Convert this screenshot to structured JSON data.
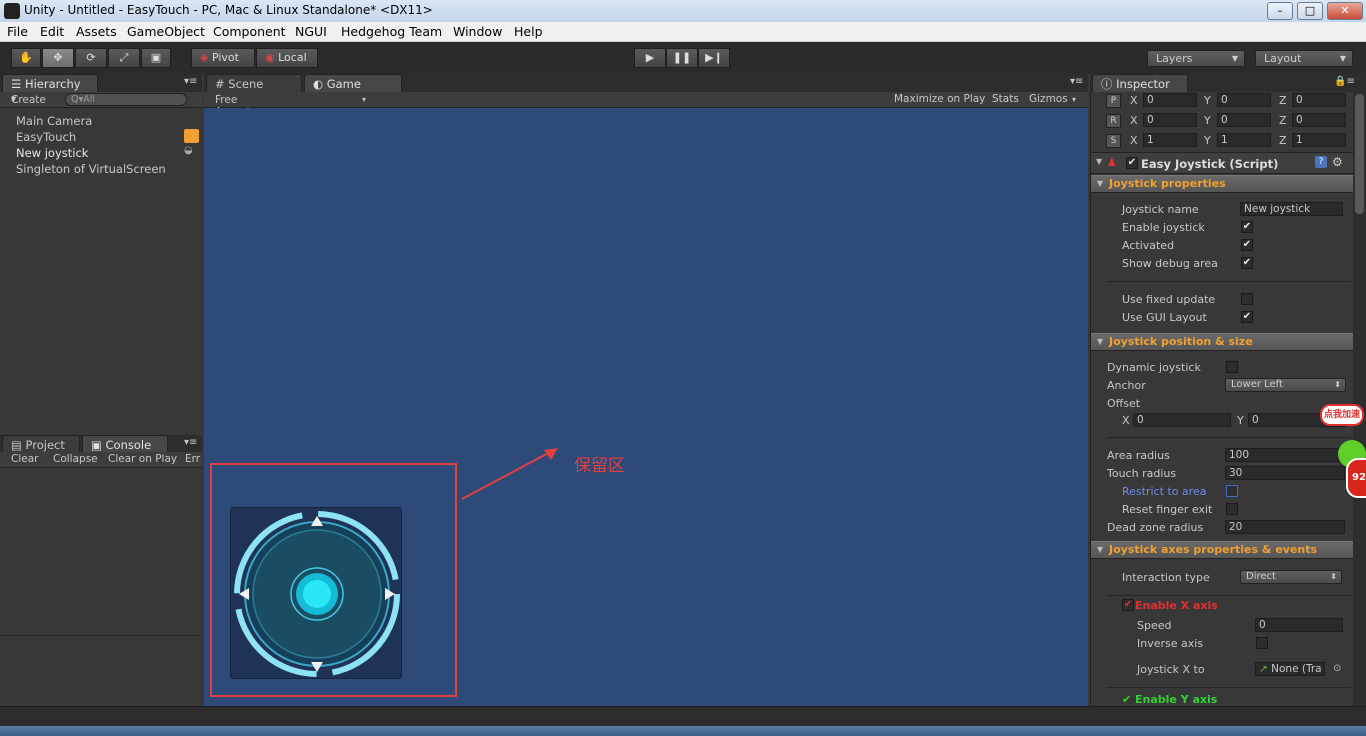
{
  "window": {
    "title": "Unity - Untitled - EasyTouch - PC, Mac & Linux Standalone* <DX11>",
    "min": "–",
    "max": "□",
    "close": "✕"
  },
  "menu": [
    "File",
    "Edit",
    "Assets",
    "GameObject",
    "Component",
    "NGUI",
    "Hedgehog Team",
    "Window",
    "Help"
  ],
  "toolbar": {
    "pivot": "Pivot",
    "local": "Local",
    "layers": "Layers",
    "layout": "Layout",
    "tools": [
      "hand-tool-icon",
      "move-tool-icon",
      "rotate-tool-icon",
      "scale-tool-icon",
      "rect-tool-icon"
    ]
  },
  "hierarchy": {
    "tab": "Hierarchy",
    "create": "Create",
    "search_placeholder": "Q▾All",
    "items": [
      "Main Camera",
      "EasyTouch",
      "New joystick",
      "Singleton of VirtualScreen"
    ]
  },
  "scene_tabs": {
    "scene": "Scene",
    "game": "Game"
  },
  "game_bar": {
    "aspect": "Free Aspect",
    "maximize": "Maximize on Play",
    "stats": "Stats",
    "gizmos": "Gizmos"
  },
  "bottom_panel": {
    "project": "Project",
    "console": "Console",
    "buttons": [
      "Clear",
      "Collapse",
      "Clear on Play",
      "Err"
    ]
  },
  "annotation": {
    "label": "保留区",
    "color": "#e04040"
  },
  "game_view": {
    "background": "#2e4a78"
  },
  "inspector": {
    "tab": "Inspector",
    "transform": [
      {
        "axis": "P",
        "x": "0",
        "y": "0",
        "z": "0"
      },
      {
        "axis": "R",
        "x": "0",
        "y": "0",
        "z": "0"
      },
      {
        "axis": "S",
        "x": "1",
        "y": "1",
        "z": "1"
      }
    ],
    "xyz": [
      "X",
      "Y",
      "Z"
    ],
    "component": "Easy Joystick (Script)",
    "sec1": "Joystick properties",
    "joystick_name_label": "Joystick name",
    "joystick_name_value": "New joystick",
    "enable_joystick": "Enable joystick",
    "activated": "Activated",
    "show_debug": "Show debug area",
    "use_fixed": "Use fixed update",
    "use_gui": "Use GUI Layout",
    "sec2": "Joystick position & size",
    "dynamic": "Dynamic joystick",
    "anchor_label": "Anchor",
    "anchor_value": "Lower Left",
    "offset": "Offset",
    "offset_x": "0",
    "offset_y": "0",
    "area_radius_label": "Area radius",
    "area_radius_value": "100",
    "touch_radius_label": "Touch radius",
    "touch_radius_value": "30",
    "restrict": "Restrict to area",
    "reset_finger": "Reset  finger exit",
    "dead_zone_label": "Dead zone radius",
    "dead_zone_value": "20",
    "sec3": "Joystick axes properties & events",
    "interaction_label": "Interaction type",
    "interaction_value": "Direct",
    "enable_x": "Enable X axis",
    "speed_label": "Speed",
    "speed_value": "0",
    "inverse": "Inverse axis",
    "joy_x_to_label": "Joystick X to",
    "joy_x_to_value": "None (Tra",
    "enable_y": "Enable Y axis"
  },
  "overlay": {
    "badge": "点我加速",
    "count": "92"
  },
  "check": "✔"
}
